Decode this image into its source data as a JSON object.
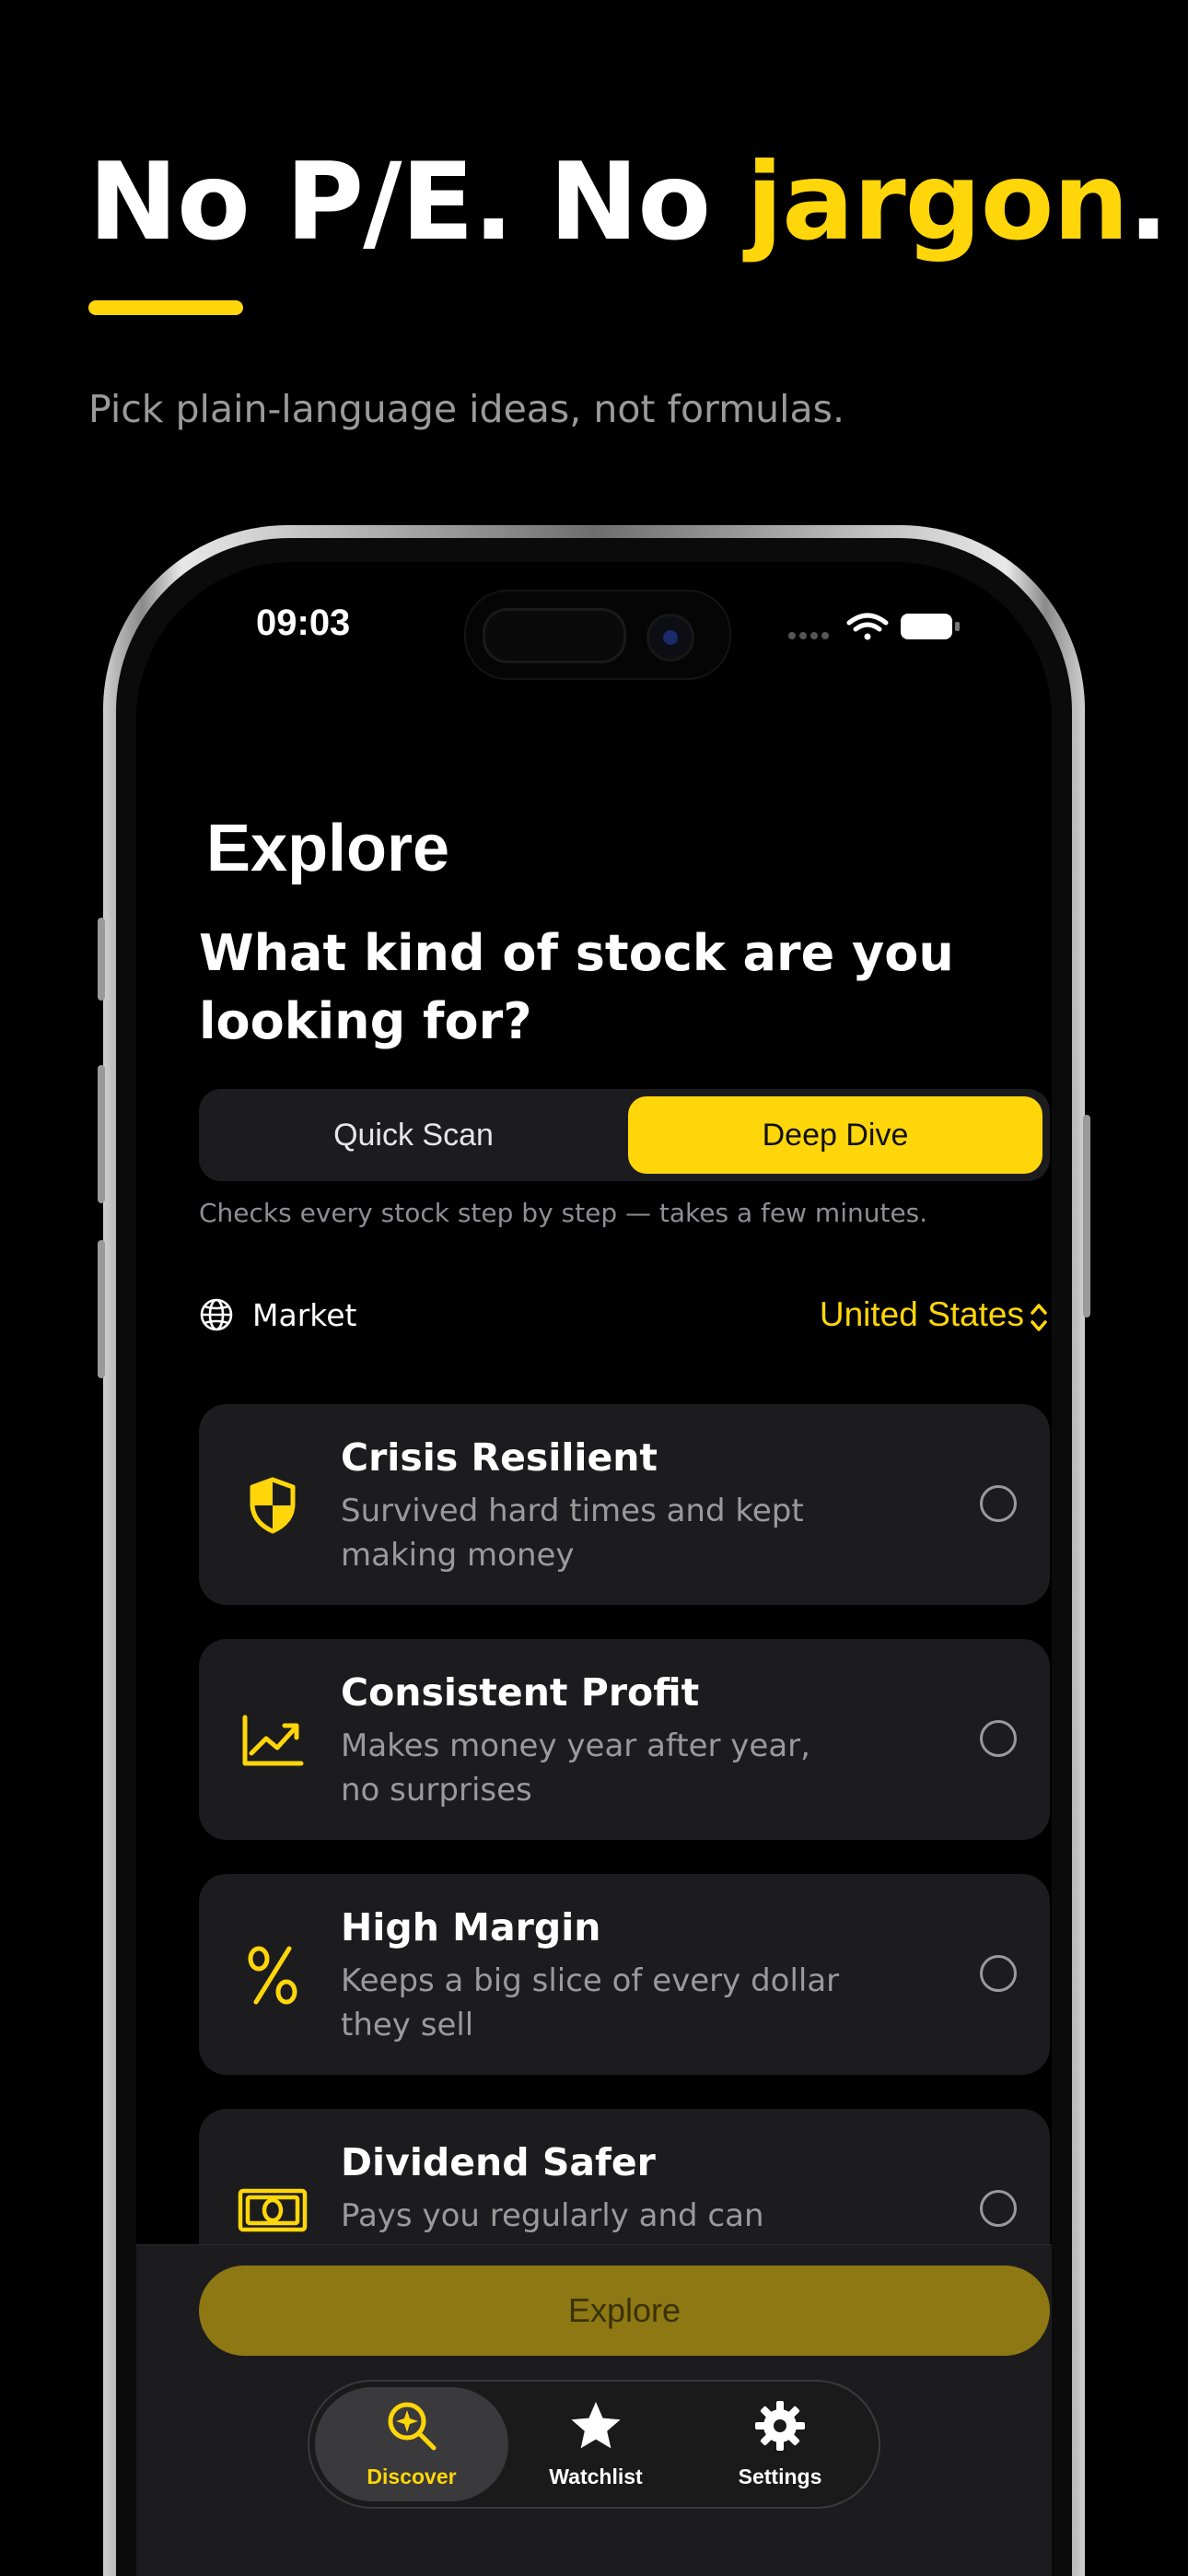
{
  "marketing": {
    "headline_part1": "No P/E. No ",
    "headline_accent": "jargon",
    "headline_end": ".",
    "subhead": "Pick plain-language ideas, not formulas."
  },
  "status_bar": {
    "time": "09:03",
    "icons": [
      "cellular-signal-icon",
      "wifi-icon",
      "battery-icon"
    ]
  },
  "screen": {
    "title": "Explore",
    "question": "What kind of stock are you looking for?",
    "mode_toggle": {
      "options": [
        "Quick Scan",
        "Deep Dive"
      ],
      "selected": "Deep Dive",
      "hint": "Checks every stock step by step — takes a few minutes."
    },
    "market": {
      "icon": "globe-icon",
      "label": "Market",
      "value": "United States"
    },
    "criteria": [
      {
        "icon": "shield-icon",
        "title": "Crisis Resilient",
        "description": "Survived hard times and kept making money",
        "selected": false
      },
      {
        "icon": "trending-chart-icon",
        "title": "Consistent Profit",
        "description": "Makes money year after year, no surprises",
        "selected": false
      },
      {
        "icon": "percent-icon",
        "title": "High Margin",
        "description": "Keeps a big slice of every dollar they sell",
        "selected": false
      },
      {
        "icon": "banknote-icon",
        "title": "Dividend Safer",
        "description": "Pays you regularly and can afford to",
        "selected": false
      }
    ],
    "explore_button": "Explore"
  },
  "tab_bar": {
    "items": [
      {
        "label": "Discover",
        "icon": "discover-search-icon",
        "active": true
      },
      {
        "label": "Watchlist",
        "icon": "star-icon",
        "active": false
      },
      {
        "label": "Settings",
        "icon": "gear-icon",
        "active": false
      }
    ]
  },
  "colors": {
    "accent": "#FFD60A",
    "background": "#000000",
    "card": "#1C1C1E",
    "muted_text": "#9A9A9A",
    "explore_button_disabled": "#8D7813"
  }
}
